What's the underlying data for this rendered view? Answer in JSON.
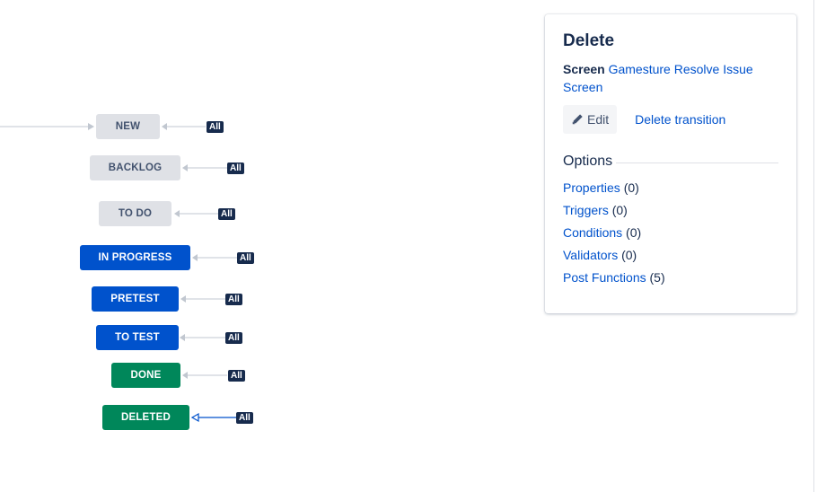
{
  "workflow": {
    "statuses": [
      {
        "key": "new",
        "label": "NEW",
        "category": "grey",
        "all": "All"
      },
      {
        "key": "backlog",
        "label": "BACKLOG",
        "category": "grey",
        "all": "All"
      },
      {
        "key": "todo",
        "label": "TO DO",
        "category": "grey",
        "all": "All"
      },
      {
        "key": "in-progress",
        "label": "IN PROGRESS",
        "category": "blue",
        "all": "All"
      },
      {
        "key": "pretest",
        "label": "PRETEST",
        "category": "blue",
        "all": "All"
      },
      {
        "key": "to-test",
        "label": "TO TEST",
        "category": "blue",
        "all": "All"
      },
      {
        "key": "done",
        "label": "DONE",
        "category": "green",
        "all": "All"
      },
      {
        "key": "deleted",
        "label": "DELETED",
        "category": "green",
        "all": "All",
        "selected": true
      }
    ],
    "colors": {
      "grey": "#dfe1e6",
      "blue": "#0052cc",
      "green": "#00875a",
      "tag": "#172b4d",
      "arrow": "#c1c7d0",
      "selected_arrow": "#0052cc"
    }
  },
  "panel": {
    "title": "Delete",
    "screen_label": "Screen",
    "screen_link": "Gamesture Resolve Issue Screen",
    "edit_label": "Edit",
    "delete_transition_label": "Delete transition",
    "options_heading": "Options",
    "options": [
      {
        "label": "Properties",
        "count": "(0)"
      },
      {
        "label": "Triggers",
        "count": "(0)"
      },
      {
        "label": "Conditions",
        "count": "(0)"
      },
      {
        "label": "Validators",
        "count": "(0)"
      },
      {
        "label": "Post Functions",
        "count": "(5)"
      }
    ]
  }
}
